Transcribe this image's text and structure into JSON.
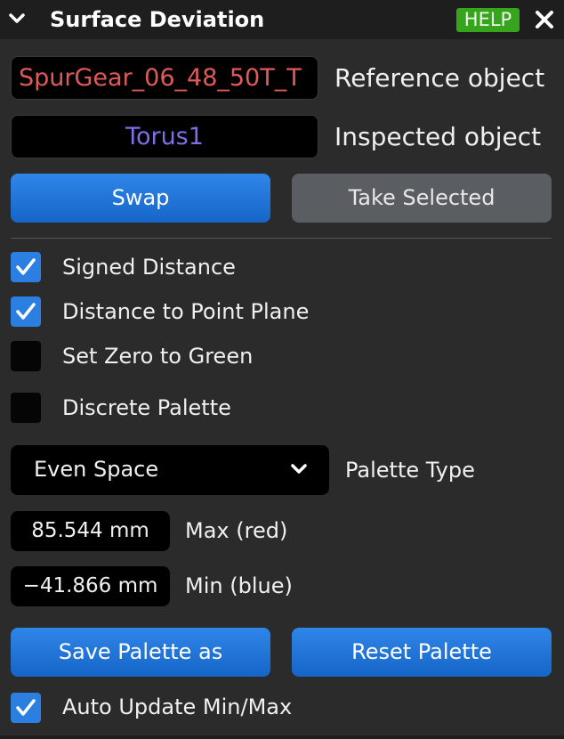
{
  "header": {
    "title": "Surface Deviation",
    "help_label": "HELP"
  },
  "objects": {
    "reference_value": "SpurGear_06_48_50T_T",
    "reference_label": "Reference object",
    "inspected_value": "Torus1",
    "inspected_label": "Inspected object"
  },
  "buttons": {
    "swap": "Swap",
    "take_selected": "Take Selected",
    "save_palette": "Save Palette as",
    "reset_palette": "Reset Palette"
  },
  "options": {
    "signed_distance": {
      "label": "Signed Distance",
      "checked": true
    },
    "distance_point_plane": {
      "label": "Distance to Point Plane",
      "checked": true
    },
    "set_zero_green": {
      "label": "Set Zero to Green",
      "checked": false
    },
    "discrete_palette": {
      "label": "Discrete Palette",
      "checked": false
    },
    "auto_update": {
      "label": "Auto Update Min/Max",
      "checked": true
    }
  },
  "palette": {
    "type_value": "Even Space",
    "type_label": "Palette Type",
    "max_value": "85.544 mm",
    "max_label": "Max (red)",
    "min_value": "−41.866 mm",
    "min_label": "Min (blue)"
  },
  "colors": {
    "accent_blue": "#2a7fe0",
    "help_green": "#35a51b",
    "reference_red": "#e05a5a",
    "inspected_purple": "#7b6fe8"
  },
  "icons": [
    "chevron-down-icon",
    "close-icon",
    "checkmark-icon"
  ]
}
